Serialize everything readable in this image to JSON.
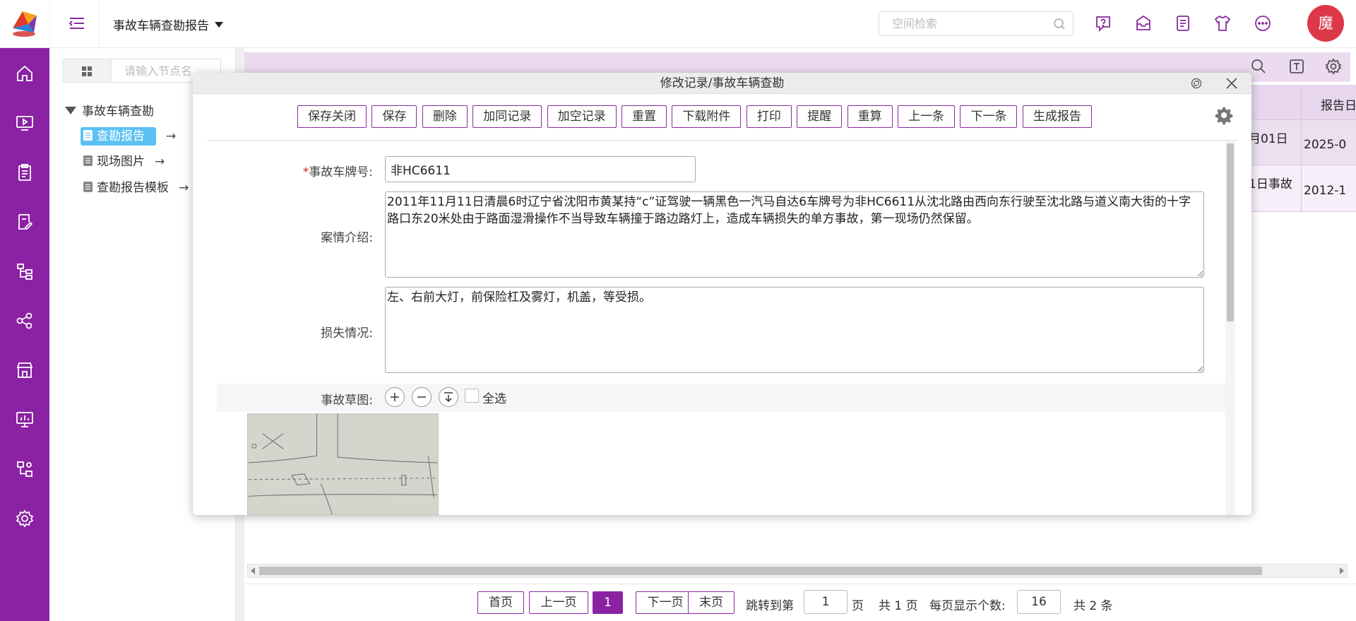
{
  "app": {
    "page_title": "事故车辆查勘报告",
    "search_placeholder": "空间检索",
    "avatar_text": "魔"
  },
  "tree": {
    "search_placeholder": "请输入节点名",
    "root": "事故车辆查勘",
    "items": [
      {
        "label": "查勘报告",
        "selected": true,
        "arrow": "→"
      },
      {
        "label": "现场图片",
        "selected": false,
        "arrow": "→"
      },
      {
        "label": "查勘报告模板",
        "selected": false,
        "arrow": "→"
      }
    ]
  },
  "background_table": {
    "header": "报告日",
    "rows": [
      {
        "col1": "月01日",
        "col2": "2025-0"
      },
      {
        "col1": "1日事故",
        "col2": "2012-1"
      }
    ]
  },
  "pagination": {
    "first": "首页",
    "prev": "上一页",
    "current": "1",
    "next": "下一页",
    "last": "末页",
    "jump_label": "跳转到第",
    "jump_value": "1",
    "page_unit": "页",
    "total_pages": "共 1 页",
    "page_size_label": "每页显示个数:",
    "page_size": "16",
    "total_records": "共 2 条"
  },
  "modal": {
    "title": "修改记录/事故车辆查勘",
    "buttons": [
      "保存关闭",
      "保存",
      "删除",
      "加同记录",
      "加空记录",
      "重置",
      "下载附件",
      "打印",
      "提醒",
      "重算",
      "上一条",
      "下一条",
      "生成报告"
    ],
    "fields": {
      "plate_label": "事故车牌号:",
      "plate_required_mark": "*",
      "plate_value": "非HC6611",
      "case_label": "案情介绍:",
      "case_value": "2011年11月11日清晨6时辽宁省沈阳市黄某持“c”证驾驶一辆黑色一汽马自达6车牌号为非HC6611从沈北路由西向东行驶至沈北路与道义南大街的十字路口东20米处由于路面湿滑操作不当导致车辆撞于路边路灯上，造成车辆损失的单方事故，第一现场仍然保留。",
      "loss_label": "损失情况:",
      "loss_value": "左、右前大灯，前保险杠及雾灯，机盖，等受损。",
      "sketch_label": "事故草图:",
      "select_all": "全选"
    }
  },
  "colors": {
    "brand": "#8a22a3",
    "selected_tree": "#5bc1f2",
    "avatar": "#dc3848"
  }
}
